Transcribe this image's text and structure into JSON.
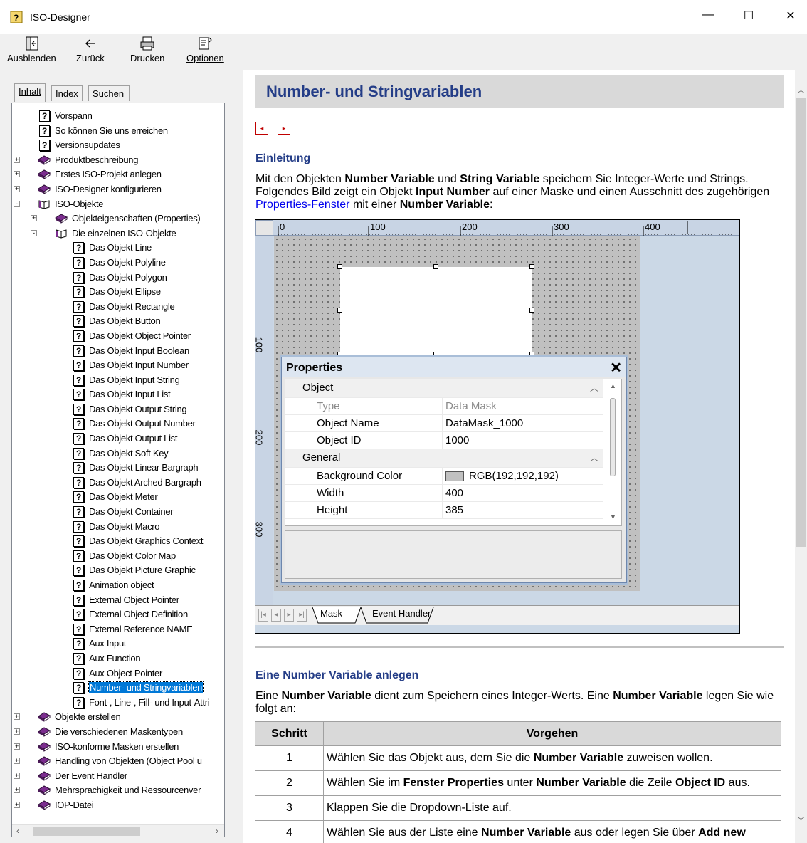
{
  "window": {
    "title": "ISO-Designer",
    "minimize": "—",
    "maximize": "☐",
    "close": "✕"
  },
  "toolbar": {
    "hide": "Ausblenden",
    "back": "Zurück",
    "print": "Drucken",
    "options": "Optionen"
  },
  "tabs": {
    "contents": "Inhalt",
    "index": "Index",
    "search": "Suchen"
  },
  "tree": [
    {
      "label": "Vorspann",
      "icon": "help-page-icon",
      "level": 0,
      "expander": ""
    },
    {
      "label": "So können Sie uns erreichen",
      "icon": "help-page-icon",
      "level": 0,
      "expander": ""
    },
    {
      "label": "Versionsupdates",
      "icon": "help-page-icon",
      "level": 0,
      "expander": ""
    },
    {
      "label": "Produktbeschreibung",
      "icon": "book-icon",
      "level": 0,
      "expander": "+"
    },
    {
      "label": "Erstes ISO-Projekt anlegen",
      "icon": "book-icon",
      "level": 0,
      "expander": "+"
    },
    {
      "label": "ISO-Designer konfigurieren",
      "icon": "book-icon",
      "level": 0,
      "expander": "+"
    },
    {
      "label": "ISO-Objekte",
      "icon": "open-book-icon",
      "level": 0,
      "expander": "-"
    },
    {
      "label": "Objekteigenschaften (Properties)",
      "icon": "book-icon",
      "level": 1,
      "expander": "+"
    },
    {
      "label": "Die einzelnen ISO-Objekte",
      "icon": "open-book-icon",
      "level": 1,
      "expander": "-"
    },
    {
      "label": "Das Objekt Line",
      "icon": "help-page-icon",
      "level": 2,
      "expander": ""
    },
    {
      "label": "Das Objekt Polyline",
      "icon": "help-page-icon",
      "level": 2,
      "expander": ""
    },
    {
      "label": "Das Objekt Polygon",
      "icon": "help-page-icon",
      "level": 2,
      "expander": ""
    },
    {
      "label": "Das Objekt Ellipse",
      "icon": "help-page-icon",
      "level": 2,
      "expander": ""
    },
    {
      "label": "Das Objekt Rectangle",
      "icon": "help-page-icon",
      "level": 2,
      "expander": ""
    },
    {
      "label": "Das Objekt Button",
      "icon": "help-page-icon",
      "level": 2,
      "expander": ""
    },
    {
      "label": "Das Objekt Object Pointer",
      "icon": "help-page-icon",
      "level": 2,
      "expander": ""
    },
    {
      "label": "Das Objekt Input Boolean",
      "icon": "help-page-icon",
      "level": 2,
      "expander": ""
    },
    {
      "label": "Das Objekt Input Number",
      "icon": "help-page-icon",
      "level": 2,
      "expander": ""
    },
    {
      "label": "Das Objekt Input String",
      "icon": "help-page-icon",
      "level": 2,
      "expander": ""
    },
    {
      "label": "Das Objekt Input List",
      "icon": "help-page-icon",
      "level": 2,
      "expander": ""
    },
    {
      "label": "Das Objekt Output String",
      "icon": "help-page-icon",
      "level": 2,
      "expander": ""
    },
    {
      "label": "Das Objekt Output Number",
      "icon": "help-page-icon",
      "level": 2,
      "expander": ""
    },
    {
      "label": "Das Objekt Output List",
      "icon": "help-page-icon",
      "level": 2,
      "expander": ""
    },
    {
      "label": "Das Objekt Soft Key",
      "icon": "help-page-icon",
      "level": 2,
      "expander": ""
    },
    {
      "label": "Das Objekt Linear Bargraph",
      "icon": "help-page-icon",
      "level": 2,
      "expander": ""
    },
    {
      "label": "Das Objekt Arched Bargraph",
      "icon": "help-page-icon",
      "level": 2,
      "expander": ""
    },
    {
      "label": "Das Objekt Meter",
      "icon": "help-page-icon",
      "level": 2,
      "expander": ""
    },
    {
      "label": "Das Objekt Container",
      "icon": "help-page-icon",
      "level": 2,
      "expander": ""
    },
    {
      "label": "Das Objekt Macro",
      "icon": "help-page-icon",
      "level": 2,
      "expander": ""
    },
    {
      "label": "Das Objekt Graphics Context",
      "icon": "help-page-icon",
      "level": 2,
      "expander": ""
    },
    {
      "label": "Das Objekt Color Map",
      "icon": "help-page-icon",
      "level": 2,
      "expander": ""
    },
    {
      "label": "Das Objekt Picture Graphic",
      "icon": "help-page-icon",
      "level": 2,
      "expander": ""
    },
    {
      "label": "Animation object",
      "icon": "help-page-icon",
      "level": 2,
      "expander": ""
    },
    {
      "label": "External Object Pointer",
      "icon": "help-page-icon",
      "level": 2,
      "expander": ""
    },
    {
      "label": "External Object Definition",
      "icon": "help-page-icon",
      "level": 2,
      "expander": ""
    },
    {
      "label": "External Reference NAME",
      "icon": "help-page-icon",
      "level": 2,
      "expander": ""
    },
    {
      "label": "Aux Input",
      "icon": "help-page-icon",
      "level": 2,
      "expander": ""
    },
    {
      "label": "Aux Function",
      "icon": "help-page-icon",
      "level": 2,
      "expander": ""
    },
    {
      "label": "Aux Object Pointer",
      "icon": "help-page-icon",
      "level": 2,
      "expander": ""
    },
    {
      "label": "Number- und Stringvariablen",
      "icon": "help-page-icon",
      "level": 2,
      "expander": "",
      "selected": true
    },
    {
      "label": "Font-, Line-, Fill- und Input-Attri",
      "icon": "help-page-icon",
      "level": 2,
      "expander": ""
    },
    {
      "label": "Objekte erstellen",
      "icon": "book-icon",
      "level": 0,
      "expander": "+"
    },
    {
      "label": "Die verschiedenen Maskentypen",
      "icon": "book-icon",
      "level": 0,
      "expander": "+"
    },
    {
      "label": "ISO-konforme Masken erstellen",
      "icon": "book-icon",
      "level": 0,
      "expander": "+"
    },
    {
      "label": "Handling von Objekten (Object Pool u",
      "icon": "book-icon",
      "level": 0,
      "expander": "+"
    },
    {
      "label": "Der Event Handler",
      "icon": "book-icon",
      "level": 0,
      "expander": "+"
    },
    {
      "label": "Mehrsprachigkeit und Ressourcenver",
      "icon": "book-icon",
      "level": 0,
      "expander": "+"
    },
    {
      "label": "IOP-Datei",
      "icon": "book-icon",
      "level": 0,
      "expander": "+"
    }
  ],
  "page": {
    "title": "Number- und Stringvariablen",
    "prev": "◂",
    "next": "▸",
    "intro_heading": "Einleitung",
    "intro_p1_a": "Mit den Objekten ",
    "intro_p1_b": "Number Variable",
    "intro_p1_c": " und ",
    "intro_p1_d": "String Variable",
    "intro_p1_e": " speichern Sie Integer-Werte und Strings. Folgendes Bild zeigt ein Objekt ",
    "intro_p1_f": "Input Number",
    "intro_p1_g": " auf einer Maske und einen Ausschnitt des zugehörigen ",
    "intro_link": "Properties-Fenster",
    "intro_p1_h": " mit einer ",
    "intro_p1_i": "Number Variable",
    "intro_p1_j": ":",
    "section2_heading": "Eine Number Variable anlegen",
    "s2_a": "Eine ",
    "s2_b": "Number Variable",
    "s2_c": " dient zum Speichern eines Integer-Werts. Eine ",
    "s2_d": "Number Variable",
    "s2_e": " legen Sie wie folgt an:"
  },
  "figure": {
    "ruler_top": [
      "0",
      "100",
      "200",
      "300",
      "400"
    ],
    "ruler_left": [
      "100",
      "200",
      "300"
    ],
    "props_title": "Properties",
    "props_close": "✕",
    "rows": [
      {
        "type": "cat",
        "key": "Object",
        "value": ""
      },
      {
        "type": "row",
        "key": "Type",
        "value": "Data Mask",
        "dim": true
      },
      {
        "type": "row",
        "key": "Object Name",
        "value": "DataMask_1000"
      },
      {
        "type": "row",
        "key": "Object ID",
        "value": "1000"
      },
      {
        "type": "cat",
        "key": "General",
        "value": ""
      },
      {
        "type": "row",
        "key": "Background Color",
        "value": "RGB(192,192,192)",
        "swatch": "#c0c0c0"
      },
      {
        "type": "row",
        "key": "Width",
        "value": "400"
      },
      {
        "type": "row",
        "key": "Height",
        "value": "385"
      }
    ],
    "tab_mask": "Mask",
    "tab_event": "Event Handler"
  },
  "steps": {
    "col_step": "Schritt",
    "col_action": "Vorgehen",
    "rows": [
      {
        "n": "1",
        "parts": [
          [
            "Wählen Sie das Objekt aus, dem Sie die ",
            false
          ],
          [
            "Number Variable",
            true
          ],
          [
            " zuweisen wollen.",
            false
          ]
        ]
      },
      {
        "n": "2",
        "parts": [
          [
            "Wählen Sie im ",
            false
          ],
          [
            "Fenster Properties",
            true
          ],
          [
            " unter ",
            false
          ],
          [
            "Number Variable",
            true
          ],
          [
            " die Zeile ",
            false
          ],
          [
            "Object ID",
            true
          ],
          [
            " aus.",
            false
          ]
        ]
      },
      {
        "n": "3",
        "parts": [
          [
            "Klappen Sie die Dropdown-Liste auf.",
            false
          ]
        ]
      },
      {
        "n": "4",
        "parts": [
          [
            "Wählen Sie aus der Liste eine ",
            false
          ],
          [
            "Number Variable",
            true
          ],
          [
            " aus oder legen Sie über ",
            false
          ],
          [
            "Add new",
            true
          ]
        ]
      }
    ]
  },
  "colors": {
    "heading": "#243d87",
    "selection": "#0078d7",
    "link": "#0000ee"
  }
}
